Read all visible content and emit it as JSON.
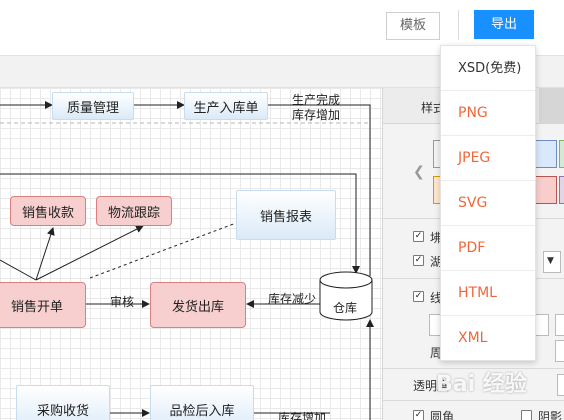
{
  "toolbar": {
    "template_label": "模板",
    "export_label": "导出"
  },
  "export_menu": {
    "items": [
      "XSD(免费)",
      "PNG",
      "JPEG",
      "SVG",
      "PDF",
      "HTML",
      "XML"
    ]
  },
  "diagram": {
    "nodes": {
      "quality": "质量管理",
      "production_in": "生产入库单",
      "sales_receipt": "销售收款",
      "logistics": "物流跟踪",
      "sales_report": "销售报表",
      "sales_order": "销售开单",
      "ship_out": "发货出库",
      "warehouse": "仓库",
      "purchase_receive": "采购收货",
      "qc_in": "品检后入库"
    },
    "labels": {
      "production_done_1": "生产完成",
      "production_done_2": "库存增加",
      "audit": "审核",
      "stock_decrease": "库存减少",
      "stock_increase": "库存增加"
    }
  },
  "right_panel": {
    "style_tab": "样式",
    "row1_fragment": "坲",
    "row2_fragment": "湖",
    "row3_fragment": "线",
    "row4_fragment": "周",
    "transparency_label": "透明度",
    "round_label": "圆角",
    "shadow_label": "阴影",
    "select_arrow": "▼",
    "swatch_colors": [
      "#ffffff",
      "#dae8fc",
      "#d5e8d4",
      "#ffe6cc",
      "#f8cecc",
      "#e1d5e7"
    ]
  },
  "watermark": "Bai 经验"
}
